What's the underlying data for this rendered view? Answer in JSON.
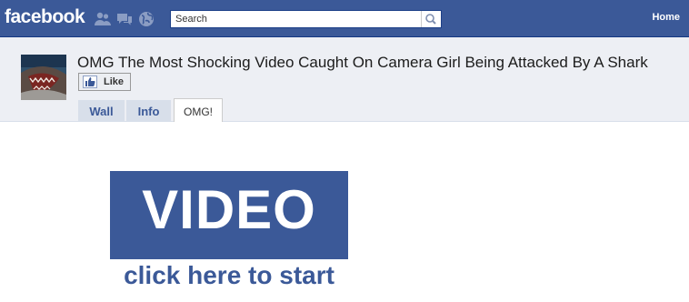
{
  "header": {
    "logo": "facebook",
    "search_placeholder": "Search",
    "home_label": "Home",
    "jewels": [
      "friend-requests-icon",
      "messages-icon",
      "notifications-icon"
    ]
  },
  "profile": {
    "title": "OMG The Most Shocking Video Caught On Camera Girl Being Attacked By A Shark",
    "like_label": "Like",
    "tabs": [
      {
        "label": "Wall",
        "active": false
      },
      {
        "label": "Info",
        "active": false
      },
      {
        "label": "OMG!",
        "active": true
      }
    ]
  },
  "content": {
    "video_label": "VIDEO",
    "cta": "click here to start"
  },
  "colors": {
    "brand": "#3b5998",
    "profile_bg": "#edeff4",
    "tab_bg": "#d8dfea"
  }
}
